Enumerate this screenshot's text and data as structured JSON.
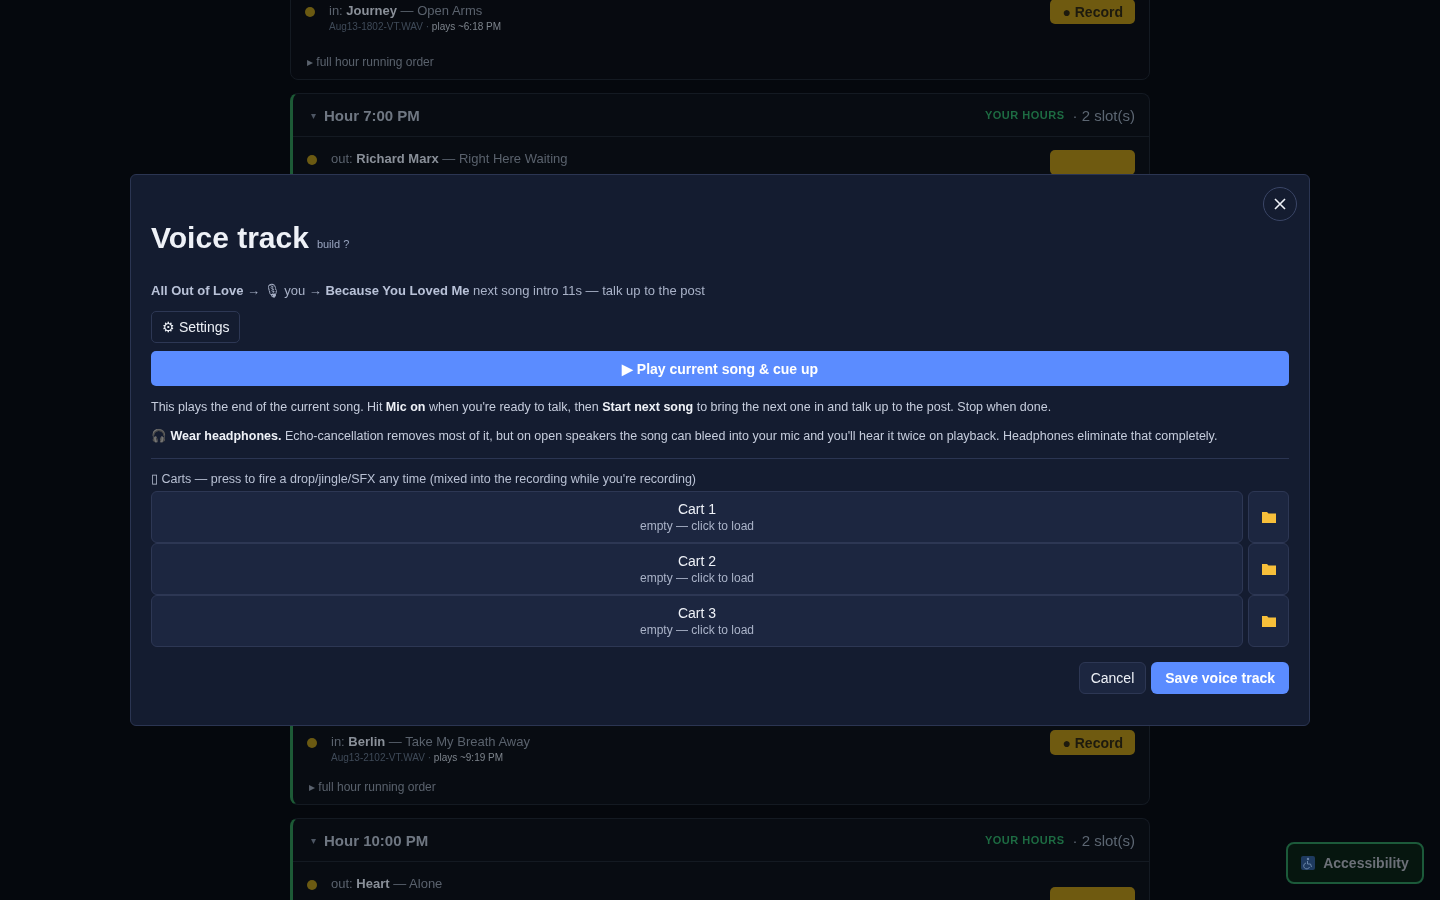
{
  "background": {
    "top_slot": {
      "direction": "in:",
      "artist": "Journey",
      "dash": "—",
      "song": "Open Arms",
      "file": "Aug13-1802-VT.WAV",
      "dot": "·",
      "plays": "plays ~6:18 PM",
      "record": "● Record"
    },
    "top_running_order": "▸ full hour running order",
    "hour_7": {
      "caret": "▾",
      "title": "Hour 7:00 PM",
      "yours": "YOUR HOURS",
      "slots": "· 2 slot(s)"
    },
    "hour_7_slot": {
      "direction": "out:",
      "artist": "Richard Marx",
      "dash": "—",
      "song": "Right Here Waiting"
    },
    "lower_slot": {
      "direction": "in:",
      "artist": "Berlin",
      "dash": "—",
      "song": "Take My Breath Away",
      "file": "Aug13-2102-VT.WAV",
      "dot": "·",
      "plays": "plays ~9:19 PM",
      "record": "● Record"
    },
    "lower_running_order": "▸ full hour running order",
    "hour_10": {
      "caret": "▾",
      "title": "Hour 10:00 PM",
      "yours": "YOUR HOURS",
      "slots": "· 2 slot(s)"
    },
    "hour_10_slot": {
      "direction": "out:",
      "artist": "Heart",
      "dash": "—",
      "song": "Alone"
    }
  },
  "modal": {
    "title": "Voice track",
    "build": "build ?",
    "flow": "**All Out of Love** → 🎙 you → **Because You Loved Me** next song intro 11s — talk up to the post",
    "settings": "⚙ Settings",
    "play": "▶ Play current song & cue up",
    "help": "This plays the end of the current song. Hit **Mic on** when you're ready to talk, then **Start next song** to bring the next one in and talk up to the post. Stop when done.",
    "headphones": "🎧 **Wear headphones.** Echo-cancellation removes most of it, but on open speakers the song can bleed into your mic and you'll hear it twice on playback. Headphones eliminate that completely.",
    "carts_label": "▯ Carts — press to fire a drop/jingle/SFX any time (mixed into the recording while you're recording)",
    "carts": [
      {
        "name": "Cart 1",
        "status": "empty — click to load"
      },
      {
        "name": "Cart 2",
        "status": "empty — click to load"
      },
      {
        "name": "Cart 3",
        "status": "empty — click to load"
      }
    ],
    "cancel": "Cancel",
    "save": "Save voice track"
  },
  "accessibility": "Accessibility"
}
